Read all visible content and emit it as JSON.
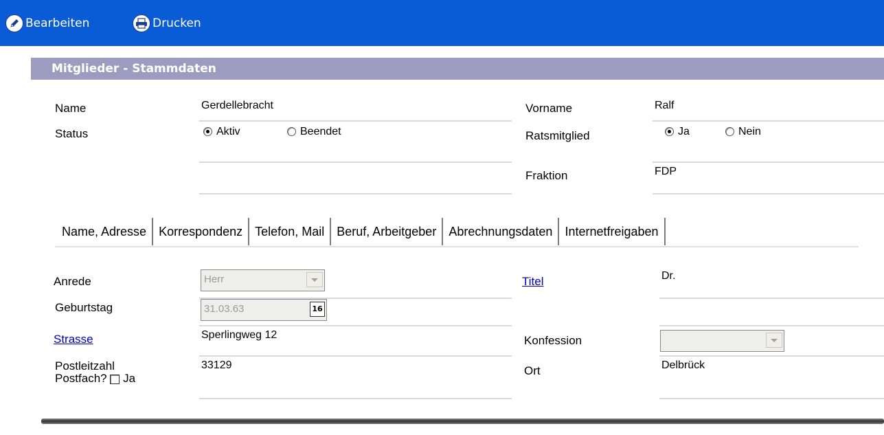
{
  "toolbar": {
    "edit_label": "Bearbeiten",
    "print_label": "Drucken",
    "bg": "#0a5bd6"
  },
  "panel": {
    "title": "Mitglieder - Stammdaten"
  },
  "header_form": {
    "name_label": "Name",
    "name_value": "Gerdellebracht",
    "vorname_label": "Vorname",
    "vorname_value": "Ralf",
    "status_label": "Status",
    "status_opt1": "Aktiv",
    "status_opt2": "Beendet",
    "rats_label": "Ratsmitglied",
    "rats_opt1": "Ja",
    "rats_opt2": "Nein",
    "fraktion_label": "Fraktion",
    "fraktion_value": "FDP"
  },
  "tabs": [
    "Name, Adresse",
    "Korrespondenz",
    "Telefon, Mail",
    "Beruf, Arbeitgeber",
    "Abrechnungsdaten",
    "Internetfreigaben"
  ],
  "address": {
    "anrede_label": "Anrede",
    "anrede_value": "Herr",
    "titel_label": "Titel",
    "titel_value": "Dr.",
    "geburtstag_label": "Geburtstag",
    "geburtstag_value": "31.03.63",
    "calendar_btn": "16",
    "strasse_label": "Strasse",
    "strasse_value": "Sperlingweg 12",
    "konfession_label": "Konfession",
    "konfession_value": "",
    "plz_label": "Postleitzahl",
    "postfach_label": "Postfach?",
    "postfach_ja": "Ja",
    "plz_value": "33129",
    "ort_label": "Ort",
    "ort_value": "Delbrück"
  }
}
